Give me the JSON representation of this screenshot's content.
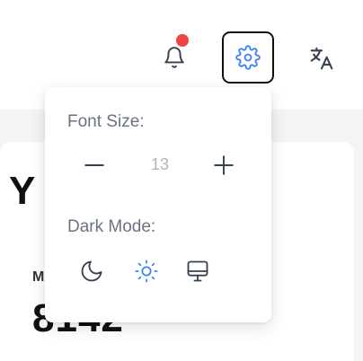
{
  "header": {
    "notifications": {
      "has_unread": true
    },
    "settings": {
      "active": true
    },
    "language": {}
  },
  "background_card": {
    "title_fragment": "Y",
    "subtitle_fragment": "M",
    "value_fragment": "8142"
  },
  "settings_menu": {
    "font_size": {
      "label": "Font Size:",
      "value": "13"
    },
    "dark_mode": {
      "label": "Dark Mode:",
      "options": [
        {
          "name": "dark",
          "icon": "moon-icon",
          "selected": false
        },
        {
          "name": "light",
          "icon": "sun-icon",
          "selected": true
        },
        {
          "name": "system",
          "icon": "monitor-icon",
          "selected": false
        }
      ]
    }
  },
  "colors": {
    "accent": "#3b82f6",
    "notification_dot": "#ef4444",
    "icon": "#374151",
    "label": "#6b7280"
  }
}
